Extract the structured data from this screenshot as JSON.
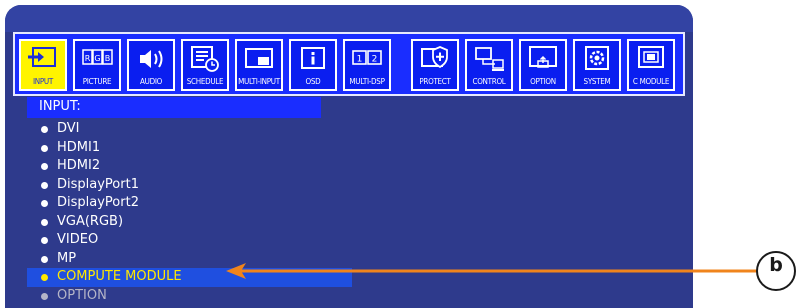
{
  "toolbar": {
    "items": [
      {
        "label": "INPUT",
        "icon": "input-icon",
        "selected": true
      },
      {
        "label": "PICTURE",
        "icon": "rgb-picture-icon"
      },
      {
        "label": "AUDIO",
        "icon": "speaker-icon"
      },
      {
        "label": "SCHEDULE",
        "icon": "schedule-icon"
      },
      {
        "label": "MULTI-INPUT",
        "icon": "multi-input-icon"
      },
      {
        "label": "OSD",
        "icon": "info-icon"
      },
      {
        "label": "MULTI-DSP",
        "icon": "multi-display-icon"
      },
      {
        "label": "PROTECT",
        "icon": "shield-plus-icon"
      },
      {
        "label": "CONTROL",
        "icon": "computer-network-icon"
      },
      {
        "label": "OPTION",
        "icon": "option-monitor-icon"
      },
      {
        "label": "SYSTEM",
        "icon": "gear-icon"
      },
      {
        "label": "C MODULE",
        "icon": "compute-module-icon"
      }
    ]
  },
  "section": {
    "title": "INPUT:"
  },
  "input_list": {
    "items": [
      {
        "label": "DVI",
        "state": "normal"
      },
      {
        "label": "HDMI1",
        "state": "normal"
      },
      {
        "label": "HDMI2",
        "state": "normal"
      },
      {
        "label": "DisplayPort1",
        "state": "normal"
      },
      {
        "label": "DisplayPort2",
        "state": "normal"
      },
      {
        "label": "VGA(RGB)",
        "state": "normal"
      },
      {
        "label": "VIDEO",
        "state": "normal"
      },
      {
        "label": "MP",
        "state": "normal"
      },
      {
        "label": "COMPUTE MODULE",
        "state": "highlighted"
      },
      {
        "label": "OPTION",
        "state": "disabled"
      }
    ]
  },
  "callout": {
    "label": "b"
  },
  "colors": {
    "osd_background": "#2e3a8c",
    "toolbar_blue": "#1a2dff",
    "selected_tile": "#fff400",
    "highlight_text": "#ffe800",
    "arrow_orange": "#f0841c"
  }
}
